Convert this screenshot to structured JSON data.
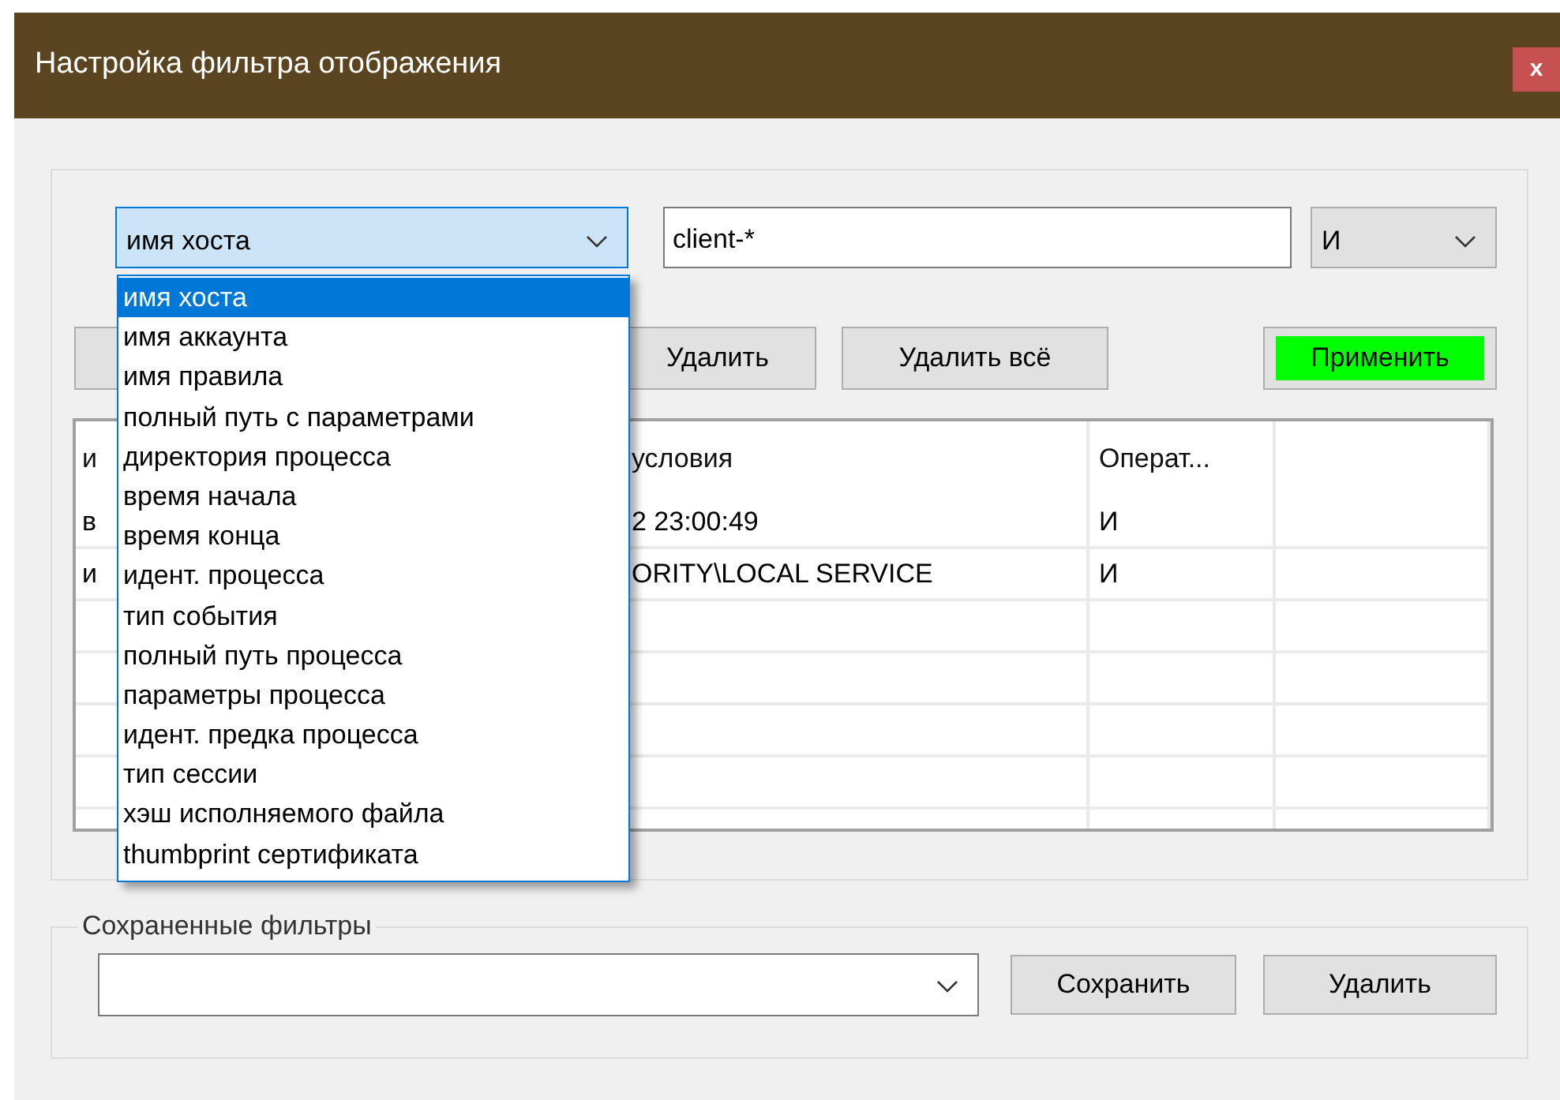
{
  "window": {
    "title": "Настройка фильтра отображения",
    "close": "x"
  },
  "condition": {
    "field": {
      "value": "имя хоста",
      "expanded": true
    },
    "pattern": {
      "value": "client-*"
    },
    "operator": {
      "value": "И"
    }
  },
  "field_options": [
    {
      "label": "имя хоста",
      "selected": true
    },
    {
      "label": "имя аккаунта",
      "selected": false
    },
    {
      "label": "имя правила",
      "selected": false
    },
    {
      "label": "полный путь с параметрами",
      "selected": false
    },
    {
      "label": "директория процесса",
      "selected": false
    },
    {
      "label": "время начала",
      "selected": false
    },
    {
      "label": "время конца",
      "selected": false
    },
    {
      "label": "идент. процесса",
      "selected": false
    },
    {
      "label": "тип события",
      "selected": false
    },
    {
      "label": "полный путь процесса",
      "selected": false
    },
    {
      "label": "параметры процесса",
      "selected": false
    },
    {
      "label": "идент. предка процесса",
      "selected": false
    },
    {
      "label": "тип сессии",
      "selected": false
    },
    {
      "label": "хэш исполняемого файла",
      "selected": false
    },
    {
      "label": "thumbprint сертификата",
      "selected": false
    }
  ],
  "buttons": [
    {
      "label": "Удалить",
      "highlighted": false
    },
    {
      "label": "Удалить всё",
      "highlighted": false
    },
    {
      "label": "Применить",
      "highlighted": true
    }
  ],
  "table": {
    "columns": [
      "и",
      "условия",
      "Операт..."
    ],
    "rows": [
      [
        "в",
        "2 23:00:49",
        "И"
      ],
      [
        "и",
        "ORITY\\LOCAL SERVICE",
        "И"
      ]
    ]
  },
  "saved_filters": {
    "legend": "Сохраненные фильтры",
    "buttons": [
      "Сохранить",
      "Удалить"
    ]
  }
}
